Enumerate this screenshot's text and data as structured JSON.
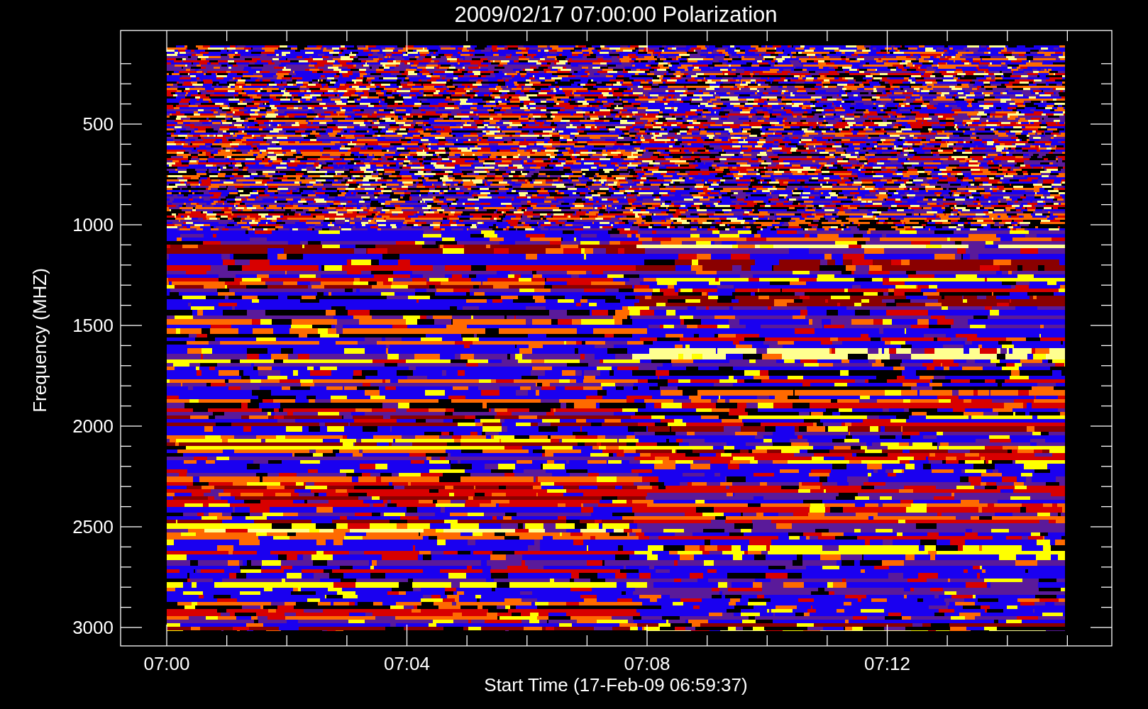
{
  "title": "2009/02/17 07:00:00 Polarization",
  "y_axis": {
    "label": "Frequency (MHZ)",
    "ticks": [
      "500",
      "1000",
      "1500",
      "2000",
      "2500",
      "3000"
    ]
  },
  "x_axis": {
    "label": "Start Time (17-Feb-09 06:59:37)",
    "ticks": [
      "07:00",
      "07:04",
      "07:08",
      "07:12"
    ]
  }
}
